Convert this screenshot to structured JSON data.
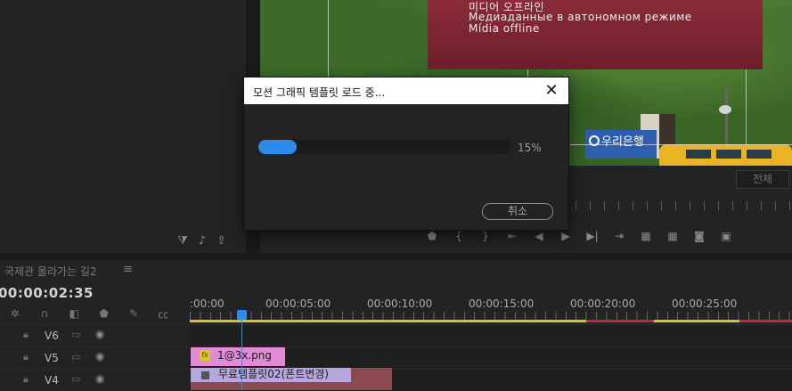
{
  "program_monitor": {
    "offline_lines": [
      "미디어 오프라인",
      "Медиаданные в автономном режиме",
      "Mídia offline"
    ],
    "sign_text": "우리은행",
    "fit_label": "전체"
  },
  "dialog": {
    "title": "모션 그래픽 템플릿 로드 중...",
    "close_icon": "close-icon",
    "progress": 0.15,
    "progress_text": "15%",
    "cancel_label": "취소",
    "accent": "#2d8ceb"
  },
  "timeline": {
    "sequence_name": "국제관 올라가는 길2",
    "menu_icon": "≡",
    "timecode": "00:00:02:35",
    "ruler": [
      ":00:00",
      "00:00:05:00",
      "00:00:10:00",
      "00:00:15:00",
      "00:00:20:00",
      "00:00:25:00"
    ],
    "tracks": [
      {
        "name": "V6"
      },
      {
        "name": "V5"
      },
      {
        "name": "V4"
      }
    ],
    "clips": {
      "png": {
        "label": "1@3x.png",
        "color": "#e28ad4"
      },
      "mogrt": {
        "label": "무료템플릿02(폰트변경)",
        "color": "#b8a6e0"
      }
    }
  }
}
